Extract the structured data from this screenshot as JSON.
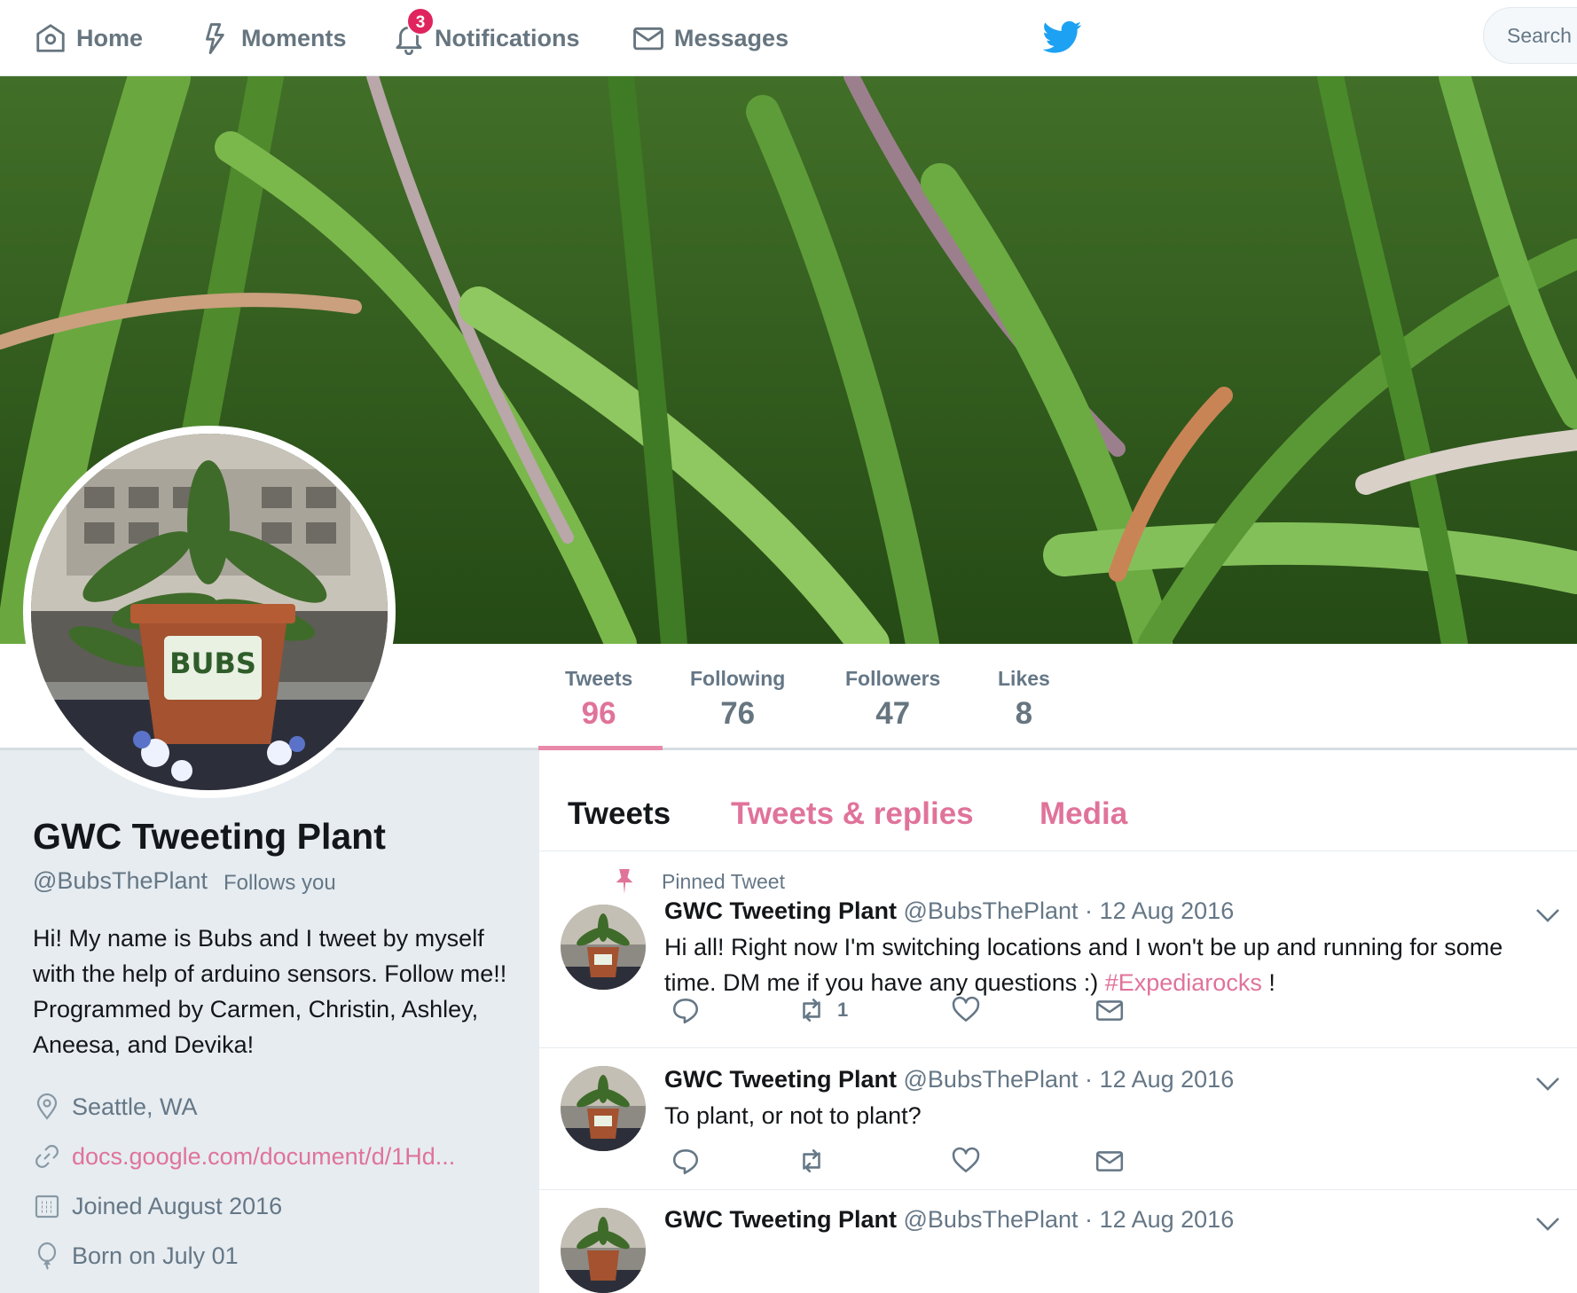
{
  "nav": {
    "home": "Home",
    "moments": "Moments",
    "notifications": "Notifications",
    "notifications_count": "3",
    "messages": "Messages",
    "search_placeholder": "Search Twitter"
  },
  "profile": {
    "name": "GWC Tweeting Plant",
    "handle": "@BubsThePlant",
    "follows_you": "Follows you",
    "bio": "Hi! My name is Bubs and I tweet by myself with the help of arduino sensors. Follow me!! Programmed by Carmen, Christin, Ashley, Aneesa, and Devika!",
    "location": "Seattle, WA",
    "website": "docs.google.com/document/d/1Hd...",
    "joined": "Joined August 2016",
    "born": "Born on July 01",
    "pot_label": "BUBS"
  },
  "stats": [
    {
      "label": "Tweets",
      "value": "96"
    },
    {
      "label": "Following",
      "value": "76"
    },
    {
      "label": "Followers",
      "value": "47"
    },
    {
      "label": "Likes",
      "value": "8"
    }
  ],
  "timeline_tabs": [
    "Tweets",
    "Tweets & replies",
    "Media"
  ],
  "pinned_label": "Pinned Tweet",
  "tweets": [
    {
      "name": "GWC Tweeting Plant",
      "handle": "@BubsThePlant",
      "dot": "·",
      "date": "12 Aug 2016",
      "text": "Hi all! Right now I'm switching locations and I won't be up and running for some time. DM me if you have any questions :) ",
      "hashtag": "#Expediarocks",
      "text_end": " !",
      "retweets": "1"
    },
    {
      "name": "GWC Tweeting Plant",
      "handle": "@BubsThePlant",
      "dot": "·",
      "date": "12 Aug 2016",
      "text": "To plant, or not to plant?"
    },
    {
      "name": "GWC Tweeting Plant",
      "handle": "@BubsThePlant",
      "dot": "·",
      "date": "12 Aug 2016"
    }
  ],
  "icons": {
    "home": "home-icon",
    "moments": "lightning-icon",
    "notifications": "bell-icon",
    "messages": "envelope-icon",
    "brand": "twitter-bird-icon",
    "location": "map-pin-icon",
    "link": "link-icon",
    "calendar": "calendar-icon",
    "balloon": "balloon-icon",
    "pin": "pin-icon",
    "reply": "reply-icon",
    "retweet": "retweet-icon",
    "like": "heart-icon",
    "dm": "envelope-icon",
    "caret": "chevron-down-icon"
  },
  "colors": {
    "accent": "#e0739a",
    "brand_blue": "#1da1f2",
    "muted": "#657786",
    "sidebar_bg": "#e6ecf0"
  }
}
